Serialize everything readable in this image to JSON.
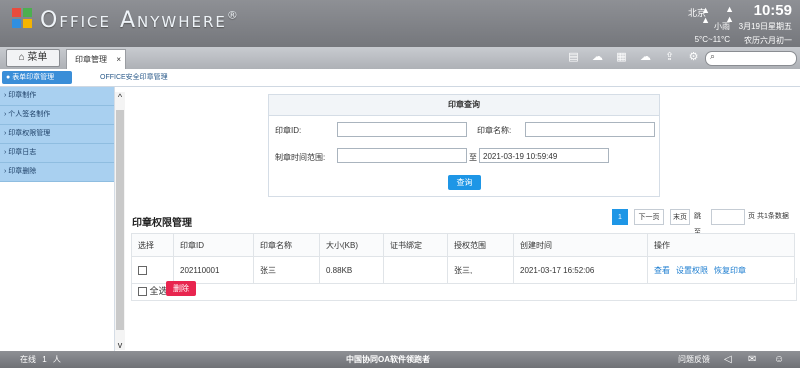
{
  "app": {
    "brand": "Office Anywhere",
    "brand_mark": "®"
  },
  "weather": {
    "city": "北京",
    "time": "10:59",
    "condition": "小雨",
    "date": "3月19日星期五",
    "temp": "5°C~11°C",
    "lunar": "农历六月初一"
  },
  "nav": {
    "menu_label": "菜单",
    "tab_label": "印章管理",
    "tab_close": "×"
  },
  "subnav": {
    "active": "表单印章管理",
    "other": "OFFICE安全印章管理"
  },
  "sidebar": {
    "items": [
      {
        "label": "印章制作"
      },
      {
        "label": "个人签名制作"
      },
      {
        "label": "印章权限管理"
      },
      {
        "label": "印章日志"
      },
      {
        "label": "印章删除"
      }
    ]
  },
  "query": {
    "title": "印章查询",
    "id_label": "印章ID:",
    "id_value": "",
    "name_label": "印章名称:",
    "name_value": "",
    "time_label": "制章时间范围:",
    "time_from": "",
    "to_label": "至",
    "time_to": "2021-03-19 10:59:49",
    "button": "查询"
  },
  "section": {
    "title": "印章权限管理"
  },
  "pager": {
    "current": "1",
    "next": "下一页",
    "last": "末页",
    "jump": "跳至",
    "jump_value": "",
    "summary": "页 共1条数据"
  },
  "table": {
    "headers": [
      "选择",
      "印章ID",
      "印章名称",
      "大小(KB)",
      "证书绑定",
      "授权范围",
      "创建时间",
      "操作"
    ],
    "rows": [
      {
        "id": "202110001",
        "name": "张三",
        "size": "0.88KB",
        "cert": "",
        "scope": "张三,",
        "created": "2021-03-17 16:52:06",
        "actions": [
          "查看",
          "设置权限",
          "恢复印章"
        ]
      }
    ],
    "select_all": "全选",
    "delete": "删除"
  },
  "status": {
    "online_label": "在线",
    "online_count": "1",
    "online_unit": "人",
    "center": "中国协同OA软件领跑者",
    "feedback": "问题反馈"
  },
  "colors": {
    "accent": "#1e96e6",
    "danger": "#e8254f",
    "sidebar": "#a9d0f0"
  }
}
